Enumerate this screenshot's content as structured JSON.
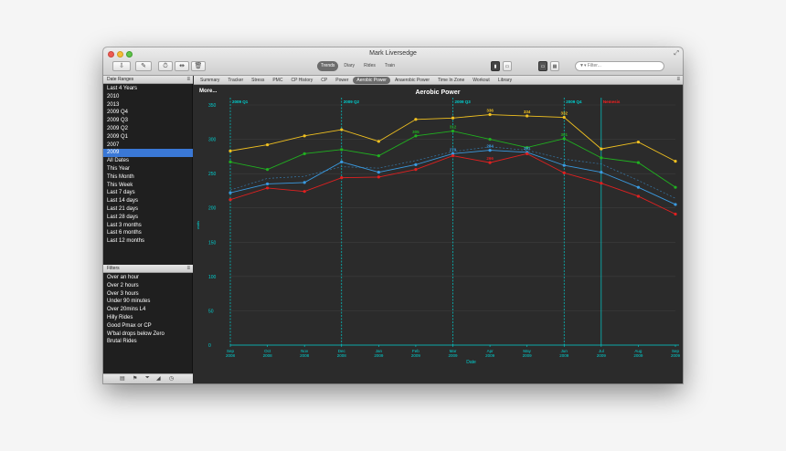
{
  "window": {
    "title": "Mark Liversedge"
  },
  "toolbar": {
    "segments": [
      "Trends",
      "Diary",
      "Rides",
      "Train"
    ],
    "active_segment": "Trends",
    "filter_placeholder": "▼▾ Filter..."
  },
  "date_ranges": {
    "header": "Date Ranges",
    "items": [
      "Last 4 Years",
      "2010",
      "2013",
      "2009 Q4",
      "2009 Q3",
      "2009 Q2",
      "2009 Q1",
      "2007",
      "2009",
      "All Dates",
      "This Year",
      "This Month",
      "This Week",
      "Last 7 days",
      "Last 14 days",
      "Last 21 days",
      "Last 28 days",
      "Last 3 months",
      "Last 6 months",
      "Last 12 months"
    ],
    "selected": "2009"
  },
  "filters": {
    "header": "Filters",
    "items": [
      "Over an hour",
      "Over 2 hours",
      "Over 3 hours",
      "Under 90 minutes",
      "Over 20mins L4",
      "Hilly Rides",
      "Good Pmax or CP",
      "W'bal drops below Zero",
      "Brutal Rides"
    ]
  },
  "tabs": {
    "items": [
      "Summary",
      "Tracker",
      "Stress",
      "PMC",
      "CP History",
      "CP",
      "Power",
      "Aerobic Power",
      "Anaerobic Power",
      "Time In Zone",
      "Workout",
      "Library"
    ],
    "active": "Aerobic Power"
  },
  "chart_more_label": "More...",
  "colors": {
    "accent": "#3a78d6",
    "axis": "#00d0d0",
    "yellow": "#f0c020",
    "green": "#20b020",
    "blue": "#3a9ae0",
    "red": "#e02020",
    "vline_red": "#ff2020"
  },
  "chart_data": {
    "type": "line",
    "title": "Aerobic Power",
    "xlabel": "Date",
    "ylabel": "watts",
    "ylim": [
      0,
      350
    ],
    "yticks": [
      0,
      50,
      100,
      150,
      200,
      250,
      300,
      350
    ],
    "grid": true,
    "categories": [
      [
        "Sep",
        "2008"
      ],
      [
        "Oct",
        "2008"
      ],
      [
        "Nov",
        "2008"
      ],
      [
        "Dec",
        "2008"
      ],
      [
        "Jan",
        "2009"
      ],
      [
        "Feb",
        "2009"
      ],
      [
        "Mar",
        "2009"
      ],
      [
        "Apr",
        "2009"
      ],
      [
        "May",
        "2009"
      ],
      [
        "Jun",
        "2009"
      ],
      [
        "Jul",
        "2009"
      ],
      [
        "Aug",
        "2009"
      ],
      [
        "Sep",
        "2009"
      ]
    ],
    "series": [
      {
        "color": "#f0c020",
        "values": [
          283,
          292,
          305,
          314,
          297,
          329,
          331,
          336,
          334,
          332,
          286,
          296,
          268
        ]
      },
      {
        "color": "#20b020",
        "values": [
          267,
          256,
          279,
          285,
          276,
          305,
          312,
          300,
          288,
          301,
          273,
          266,
          230
        ]
      },
      {
        "color": "#3a9ae0",
        "values": [
          222,
          235,
          237,
          267,
          252,
          263,
          279,
          284,
          281,
          262,
          252,
          230,
          205
        ]
      },
      {
        "color": "#e02020",
        "values": [
          212,
          229,
          224,
          244,
          245,
          256,
          276,
          266,
          279,
          251,
          236,
          217,
          191
        ]
      }
    ],
    "dashed_series": [
      {
        "color": "#3a9ae0",
        "values": [
          226,
          243,
          246,
          260,
          258,
          269,
          282,
          289,
          284,
          271,
          264,
          240,
          214
        ]
      }
    ],
    "data_labels": [
      {
        "i": 7,
        "value": "336",
        "color": "#f0c020"
      },
      {
        "i": 8,
        "value": "334",
        "color": "#f0c020"
      },
      {
        "i": 9,
        "value": "332",
        "color": "#f0c020"
      },
      {
        "i": 5,
        "value": "305",
        "color": "#20b020"
      },
      {
        "i": 6,
        "value": "312",
        "color": "#20b020"
      },
      {
        "i": 9,
        "value": "301",
        "color": "#20b020"
      },
      {
        "i": 6,
        "value": "279",
        "color": "#3a9ae0"
      },
      {
        "i": 7,
        "value": "284",
        "color": "#3a9ae0"
      },
      {
        "i": 8,
        "value": "281",
        "color": "#3a9ae0"
      },
      {
        "i": 7,
        "value": "266",
        "color": "#e02020"
      }
    ],
    "markers": [
      {
        "pos": 0,
        "label": "2009 Q1",
        "color": "#00d0d0"
      },
      {
        "pos": 3,
        "label": "2009 Q2",
        "color": "#00d0d0"
      },
      {
        "pos": 6,
        "label": "2009 Q3",
        "color": "#00d0d0"
      },
      {
        "pos": 9,
        "label": "2009 Q4",
        "color": "#00d0d0"
      },
      {
        "pos": 10,
        "label": "Nemesis",
        "color": "#ff2020"
      }
    ]
  }
}
